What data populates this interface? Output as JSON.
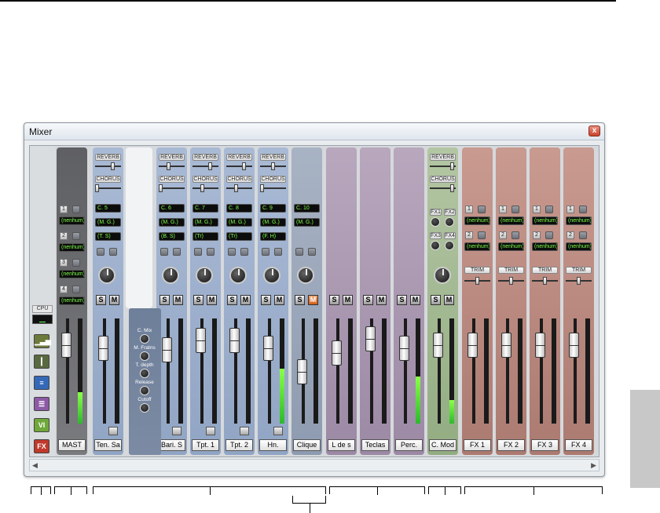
{
  "window": {
    "title": "Mixer",
    "close_label": "x"
  },
  "left_tools": {
    "cpu_label": "CPU",
    "tools": [
      {
        "name": "meter-bars-icon",
        "glyph": "▁▃▅",
        "color": "#6c7a3a"
      },
      {
        "name": "fader-tool-icon",
        "glyph": "┃",
        "color": "#5a6a40"
      },
      {
        "name": "list-icon",
        "glyph": "≡",
        "color": "#3569b8"
      },
      {
        "name": "track-list-icon",
        "glyph": "☰",
        "color": "#8c5aa5"
      },
      {
        "name": "vi-icon",
        "glyph": "VI",
        "color": "#6ea83a"
      },
      {
        "name": "fx-icon",
        "glyph": "FX",
        "color": "#c0392b"
      }
    ]
  },
  "master": {
    "name": "MAST",
    "sends": [
      {
        "num": "1",
        "value": "(nenhum)"
      },
      {
        "num": "2",
        "value": "(nenhum)"
      },
      {
        "num": "3",
        "value": "(nenhum)"
      },
      {
        "num": "4",
        "value": "(nenhum)"
      }
    ]
  },
  "strip_labels": {
    "reverb": "REVERB",
    "chorus": "CHORUS",
    "solo": "S",
    "mute": "M",
    "trim": "TRIM"
  },
  "channels": [
    {
      "name": "Ten. Sa",
      "channel": "C. 5",
      "device": "(M. G.)",
      "instrument": "(T. S)"
    },
    {
      "name": "Bari. S",
      "channel": "C. 6",
      "device": "(M. G.)",
      "instrument": "(B. S)"
    },
    {
      "name": "Tpt. 1",
      "channel": "C. 7",
      "device": "(M. G.)",
      "instrument": "(Tr)"
    },
    {
      "name": "Tpt. 2",
      "channel": "C. 8",
      "device": "(M. G.)",
      "instrument": "(Tr)"
    },
    {
      "name": "Hn.",
      "channel": "C. 9",
      "device": "(M. G.)",
      "instrument": "(F. H)"
    },
    {
      "name": "Clique",
      "channel": "C. 10",
      "device": "(M. G.)",
      "instrument": ""
    }
  ],
  "synth_params": [
    "C. Mix",
    "M. Fratns",
    "T. depth",
    "Release",
    "Cutoff"
  ],
  "groups": [
    {
      "name": "L de s"
    },
    {
      "name": "Teclas"
    },
    {
      "name": "Perc."
    }
  ],
  "comod": {
    "name": "C. Mod",
    "fx_labels": [
      "FX1",
      "FX2",
      "FX3",
      "FX4"
    ]
  },
  "fx_strips": [
    {
      "name": "FX 1",
      "send1": "(nenhum)",
      "send2": "(nenhum)",
      "n1": "1",
      "n2": "2"
    },
    {
      "name": "FX 2",
      "send1": "(nenhum)",
      "send2": "(nenhum)",
      "n1": "1",
      "n2": "2"
    },
    {
      "name": "FX 3",
      "send1": "(nenhum)",
      "send2": "(nenhum)",
      "n1": "1",
      "n2": "2"
    },
    {
      "name": "FX 4",
      "send1": "(nenhum)",
      "send2": "(nenhum)",
      "n1": "1",
      "n2": "2"
    }
  ]
}
